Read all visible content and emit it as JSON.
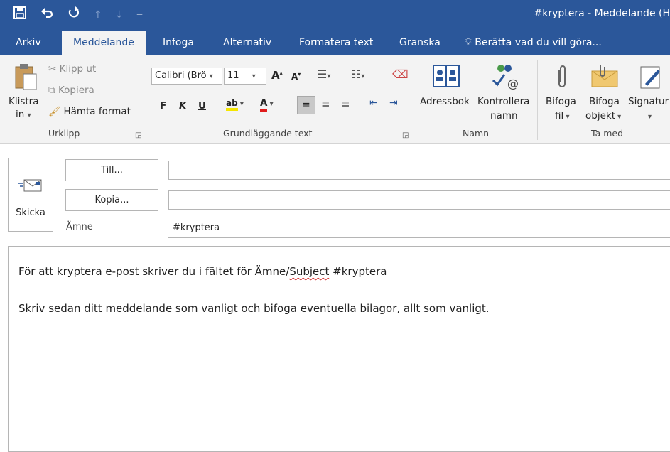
{
  "window": {
    "title": "#kryptera - Meddelande (H"
  },
  "qat": {
    "save": "save-icon",
    "undo": "undo-icon",
    "redo": "redo-icon",
    "up": "up-icon",
    "down": "down-icon",
    "customize": "qat-customize-icon"
  },
  "tabs": [
    {
      "label": "Arkiv"
    },
    {
      "label": "Meddelande"
    },
    {
      "label": "Infoga"
    },
    {
      "label": "Alternativ"
    },
    {
      "label": "Formatera text"
    },
    {
      "label": "Granska"
    }
  ],
  "tell_me": {
    "label": "Berätta vad du vill göra..."
  },
  "ribbon": {
    "clipboard": {
      "group_label": "Urklipp",
      "paste_line1": "Klistra",
      "paste_line2": "in",
      "cut": "Klipp ut",
      "copy": "Kopiera",
      "format_painter": "Hämta format"
    },
    "basic_text": {
      "group_label": "Grundläggande text",
      "font_name": "Calibri (Brö",
      "font_size": "11",
      "bold": "F",
      "italic": "K",
      "underline": "U"
    },
    "names": {
      "group_label": "Namn",
      "address_book": "Adressbok",
      "check_names_line1": "Kontrollera",
      "check_names_line2": "namn"
    },
    "include": {
      "group_label": "Ta med",
      "attach_file_line1": "Bifoga",
      "attach_file_line2": "fil",
      "attach_item_line1": "Bifoga",
      "attach_item_line2": "objekt",
      "signature": "Signatur"
    }
  },
  "compose": {
    "send_label": "Skicka",
    "to_button": "Till...",
    "cc_button": "Kopia...",
    "to_value": "",
    "cc_value": "",
    "subject_label": "Ämne",
    "subject_value": "#kryptera"
  },
  "message": {
    "line1_a": "För att kryptera e-post  skriver du i fältet  för Ämne/",
    "line1_b": "Subject",
    "line1_c": " #kryptera",
    "line2": "Skriv sedan ditt meddelande som vanligt och bifoga eventuella bilagor, allt som vanligt."
  }
}
